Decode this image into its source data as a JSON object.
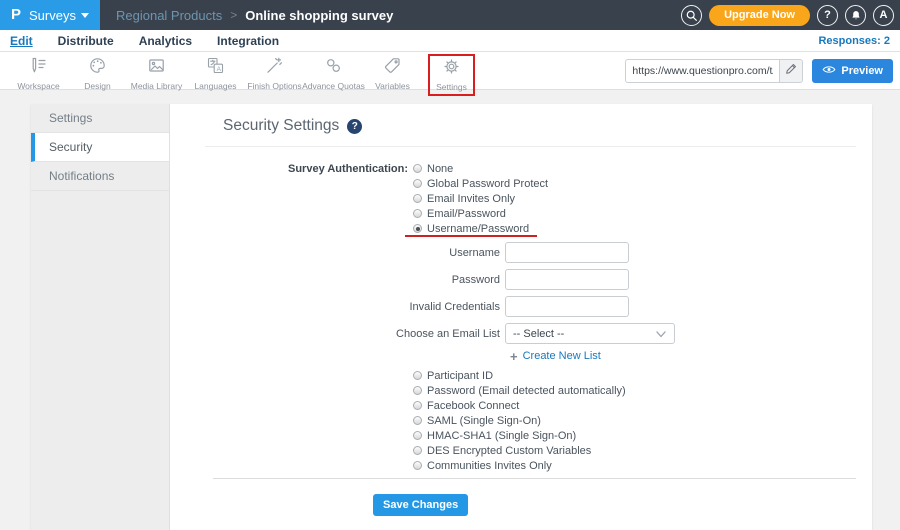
{
  "topbar": {
    "logo": "P",
    "product": "Surveys",
    "breadcrumb": {
      "folder": "Regional Products",
      "separator": ">",
      "survey": "Online shopping survey"
    },
    "search_icon": "search-icon",
    "upgrade_label": "Upgrade Now",
    "help_label": "?",
    "notifications_icon": "bell-icon",
    "avatar_label": "A"
  },
  "nav": {
    "items": [
      "Edit",
      "Distribute",
      "Analytics",
      "Integration"
    ],
    "active": "Edit",
    "responses": "Responses: 2"
  },
  "toolbar": {
    "items": [
      {
        "label": "Workspace",
        "icon": "pencil-list-icon"
      },
      {
        "label": "Design",
        "icon": "palette-icon"
      },
      {
        "label": "Media Library",
        "icon": "image-icon"
      },
      {
        "label": "Languages",
        "icon": "translate-icon"
      },
      {
        "label": "Finish Options",
        "icon": "magic-wand-icon"
      },
      {
        "label": "Advance Quotas",
        "icon": "chain-links-icon"
      },
      {
        "label": "Variables",
        "icon": "tag-icon"
      },
      {
        "label": "Settings",
        "icon": "gear-icon",
        "highlighted": true
      }
    ],
    "url_value": "https://www.questionpro.com/t/APNrfZ",
    "edit_icon": "pencil-icon",
    "preview_icon": "eye-icon",
    "preview_label": "Preview"
  },
  "sidebar": {
    "items": [
      {
        "label": "Settings",
        "active": false
      },
      {
        "label": "Security",
        "active": true
      },
      {
        "label": "Notifications",
        "active": false
      }
    ]
  },
  "main": {
    "title": "Security Settings",
    "help_icon": "help-circle-icon",
    "auth": {
      "label": "Survey Authentication:",
      "options_top": [
        "None",
        "Global Password Protect",
        "Email Invites Only",
        "Email/Password",
        "Username/Password"
      ],
      "selected": "Username/Password",
      "options_bottom": [
        "Participant ID",
        "Password (Email detected automatically)",
        "Facebook Connect",
        "SAML (Single Sign-On)",
        "HMAC-SHA1 (Single Sign-On)",
        "DES Encrypted Custom Variables",
        "Communities Invites Only"
      ]
    },
    "fields": [
      {
        "label": "Username",
        "value": ""
      },
      {
        "label": "Password",
        "value": ""
      },
      {
        "label": "Invalid Credentials",
        "value": ""
      }
    ],
    "email_list": {
      "label": "Choose an Email List",
      "value": "-- Select --"
    },
    "create_list_plus": "+",
    "create_list_label": "Create New List",
    "save_label": "Save Changes"
  },
  "colors": {
    "topbar_bg": "#39414c",
    "accent_blue": "#2498e5",
    "logo_blue": "#2a9be6",
    "upgrade_orange": "#f9a61b",
    "link_blue": "#1878be",
    "annotation_red": "#d81e1e"
  }
}
